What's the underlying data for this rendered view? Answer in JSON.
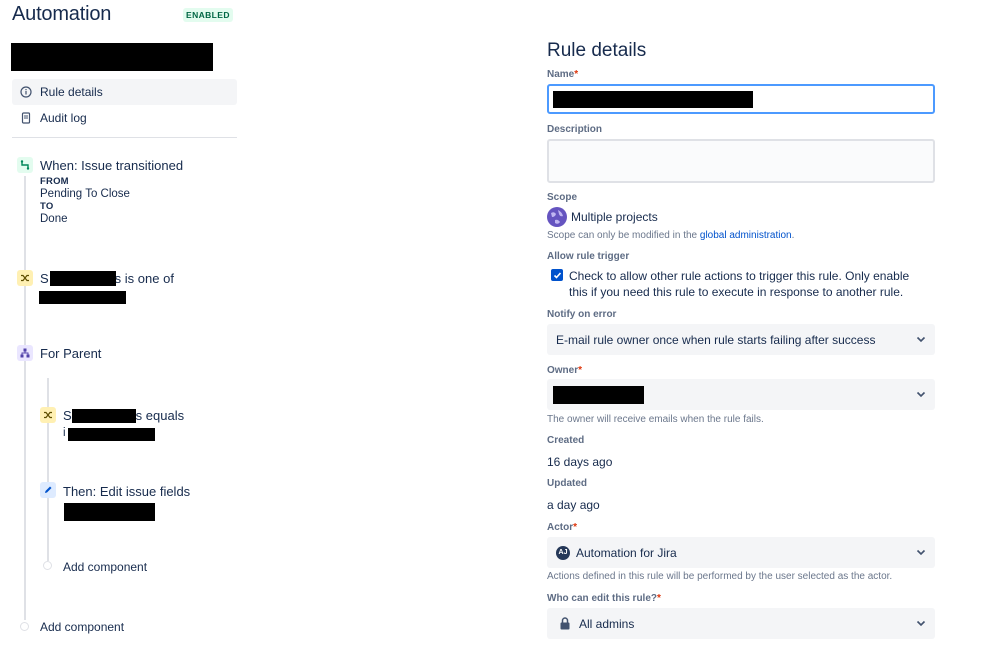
{
  "header": {
    "title": "Automation",
    "status_badge": "ENABLED"
  },
  "nav": {
    "items": [
      {
        "label": "Rule details",
        "icon": "info-icon",
        "active": true
      },
      {
        "label": "Audit log",
        "icon": "document-icon",
        "active": false
      }
    ]
  },
  "rule_flow": {
    "trigger": {
      "title": "When: Issue transitioned",
      "from_label": "FROM",
      "from_value": "Pending To Close",
      "to_label": "TO",
      "to_value": "Done",
      "icon": "trigger-icon"
    },
    "condition": {
      "title_prefix": "S",
      "title_suffix": "s is one of",
      "icon": "shuffle-icon"
    },
    "branch": {
      "title": "For Parent",
      "icon": "branch-icon",
      "condition": {
        "title_prefix": "S",
        "title_suffix": "s equals",
        "sub_prefix": "i",
        "icon": "shuffle-icon"
      },
      "action": {
        "title": "Then: Edit issue fields",
        "icon": "pencil-icon"
      },
      "add_component": "Add component"
    },
    "add_component": "Add component"
  },
  "details": {
    "title": "Rule details",
    "name": {
      "label": "Name",
      "required_mark": "*"
    },
    "description": {
      "label": "Description",
      "value": ""
    },
    "scope": {
      "label": "Scope",
      "value": "Multiple projects",
      "help_prefix": "Scope can only be modified in the ",
      "help_link": "global administration",
      "help_suffix": "."
    },
    "allow_trigger": {
      "label": "Allow rule trigger",
      "checked": true,
      "text": "Check to allow other rule actions to trigger this rule. Only enable this if you need this rule to execute in response to another rule."
    },
    "notify_on_error": {
      "label": "Notify on error",
      "selected": "E-mail rule owner once when rule starts failing after success"
    },
    "owner": {
      "label": "Owner",
      "required_mark": "*",
      "help": "The owner will receive emails when the rule fails."
    },
    "created": {
      "label": "Created",
      "value": "16 days ago"
    },
    "updated": {
      "label": "Updated",
      "value": "a day ago"
    },
    "actor": {
      "label": "Actor",
      "required_mark": "*",
      "selected": "Automation for Jira",
      "help": "Actions defined in this rule will be performed by the user selected as the actor."
    },
    "who_can_edit": {
      "label": "Who can edit this rule?",
      "required_mark": "*",
      "selected": "All admins"
    }
  },
  "colors": {
    "primary": "#0052cc",
    "text": "#172b4d",
    "subtle_text": "#5e6c84",
    "required": "#de350b",
    "enabled_badge": "#006644",
    "focus_border": "#4c9aff"
  }
}
